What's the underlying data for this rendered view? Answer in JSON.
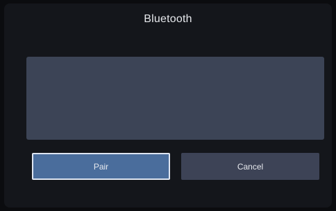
{
  "dialog": {
    "title": "Bluetooth",
    "message_lines": [
      "",
      ""
    ]
  },
  "buttons": {
    "pair_label": "Pair",
    "cancel_label": "Cancel"
  }
}
